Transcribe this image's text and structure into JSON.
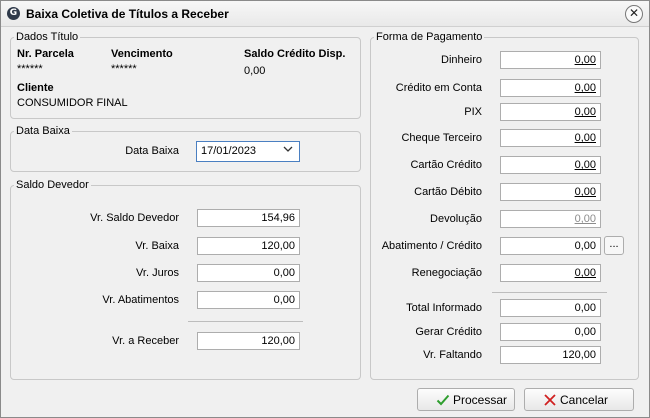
{
  "window": {
    "title": "Baixa Coletiva de Títulos a Receber",
    "app_icon": "app-logo-icon",
    "close_icon": "close-icon"
  },
  "dados": {
    "legend": "Dados Título",
    "nr_parcela_label": "Nr. Parcela",
    "nr_parcela_value": "******",
    "vencimento_label": "Vencimento",
    "vencimento_value": "******",
    "saldo_label": "Saldo Crédito Disp.",
    "saldo_value": "0,00",
    "cliente_label": "Cliente",
    "cliente_value": "CONSUMIDOR FINAL"
  },
  "data_baixa": {
    "legend": "Data Baixa",
    "label": "Data Baixa",
    "value": "17/01/2023"
  },
  "saldo_devedor": {
    "legend": "Saldo Devedor",
    "rows": [
      {
        "label": "Vr. Saldo Devedor",
        "value": "154,96"
      },
      {
        "label": "Vr. Baixa",
        "value": "120,00"
      },
      {
        "label": "Vr. Juros",
        "value": "0,00"
      },
      {
        "label": "Vr. Abatimentos",
        "value": "0,00"
      }
    ],
    "receber_label": "Vr. a Receber",
    "receber_value": "120,00"
  },
  "forma": {
    "legend": "Forma de Pagamento",
    "rows": [
      {
        "label": "Dinheiro",
        "value": "0,00"
      },
      {
        "label": "Crédito em Conta",
        "value": "0,00"
      },
      {
        "label": "PIX",
        "value": "0,00"
      },
      {
        "label": "Cheque Terceiro",
        "value": "0,00"
      },
      {
        "label": "Cartão Crédito",
        "value": "0,00"
      },
      {
        "label": "Cartão Débito",
        "value": "0,00"
      },
      {
        "label": "Devolução",
        "value": "0,00"
      },
      {
        "label": "Abatimento / Crédito",
        "value": "0,00"
      },
      {
        "label": "Renegociação",
        "value": "0,00"
      }
    ],
    "more_button": "...",
    "totals": [
      {
        "label": "Total Informado",
        "value": "0,00"
      },
      {
        "label": "Gerar Crédito",
        "value": "0,00"
      },
      {
        "label": "Vr. Faltando",
        "value": "120,00"
      }
    ]
  },
  "buttons": {
    "processar": "Processar",
    "cancelar": "Cancelar"
  },
  "colors": {
    "check": "#2e9e2e",
    "cancel_x": "#d02020",
    "focus_border": "#4a7fc1"
  }
}
